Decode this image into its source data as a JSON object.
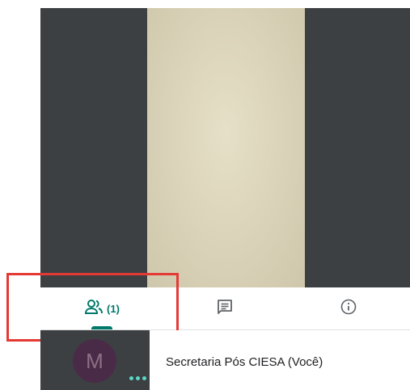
{
  "video": {},
  "tabs": {
    "people": {
      "icon": "people-icon",
      "count": "(1)"
    },
    "chat": {
      "icon": "chat-icon"
    },
    "info": {
      "icon": "info-icon"
    }
  },
  "participant": {
    "avatar_letter": "M",
    "name": "Secretaria Pós CIESA (Você)",
    "status_icon": "speaking-dots-icon"
  },
  "colors": {
    "accent": "#00796b",
    "video_background": "#3c4043",
    "highlight": "#e53935",
    "avatar_bg": "#4a2b47",
    "dots": "#5cd8c6"
  }
}
